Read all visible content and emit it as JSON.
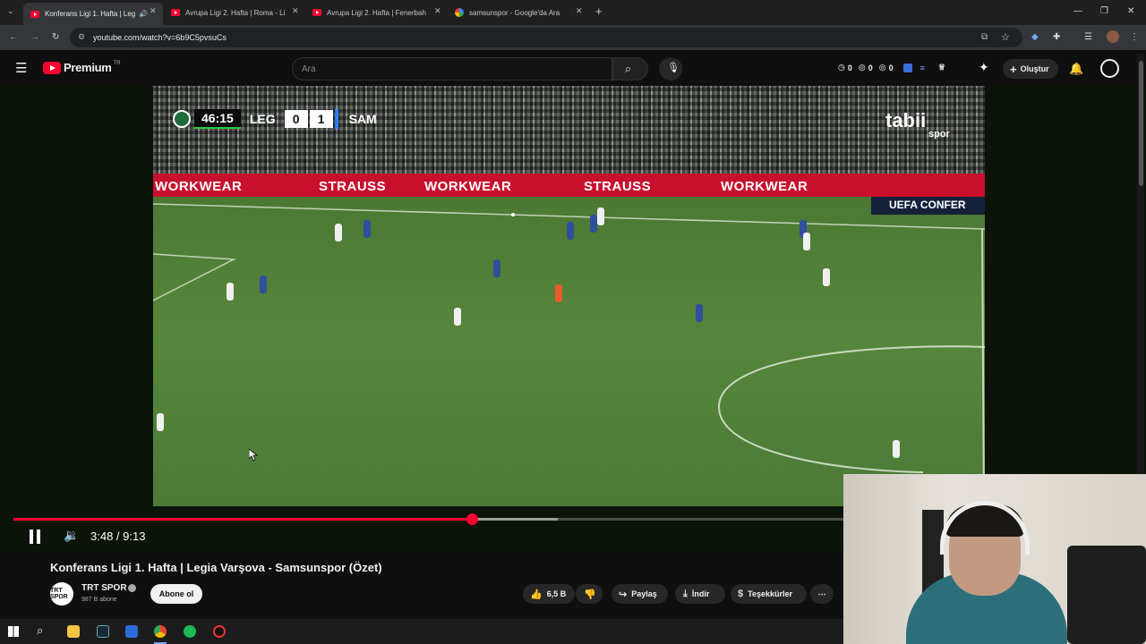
{
  "browser": {
    "tabs": [
      {
        "title": "Konferans Ligi 1. Hafta | Leg",
        "favicon": "youtube-icon",
        "active": true,
        "audio": true
      },
      {
        "title": "Avrupa Ligi 2. Hafta | Roma - Li",
        "favicon": "youtube-icon",
        "active": false
      },
      {
        "title": "Avrupa Ligi 2. Hafta | Fenerbah",
        "favicon": "youtube-icon",
        "active": false
      },
      {
        "title": "samsunspor - Google'da Ara",
        "favicon": "google-icon",
        "active": false
      }
    ],
    "url": "youtube.com/watch?v=6b9C5pvsuCs"
  },
  "youtube": {
    "logo_text": "Premium",
    "region": "TR",
    "search_placeholder": "Ara",
    "stats": [
      "0",
      "0",
      "0"
    ],
    "create_label": "Oluştur"
  },
  "video": {
    "scorebug": {
      "time": "46:15",
      "home": "LEG",
      "home_score": "0",
      "away_score": "1",
      "away": "SAM"
    },
    "ad_texts": [
      "WORKWEAR",
      "STRAUSS",
      "WORKWEAR",
      "STRAUSS",
      "WORKWEAR"
    ],
    "uefa_text": "UEFA CONFER",
    "broadcaster": "tabii",
    "broadcaster_sub": "spor"
  },
  "player": {
    "current_time": "3:48",
    "duration": "9:13",
    "time_display": "3:48 / 9:13",
    "progress_fraction": 0.5524,
    "buffered_fraction": 0.656
  },
  "details": {
    "title": "Konferans Ligi 1. Hafta | Legia Varşova - Samsunspor (Özet)",
    "channel_name": "TRT SPOR",
    "channel_avatar_text": "TRT SPOR",
    "subscribers": "987 B abone",
    "subscribe_label": "Abone ol",
    "likes": "6,5 B",
    "share_label": "Paylaş",
    "download_label": "İndir",
    "thanks_label": "Teşekkürler",
    "more_label": "⋯"
  },
  "colors": {
    "accent": "#ff0033",
    "background": "#0f0f0f"
  }
}
